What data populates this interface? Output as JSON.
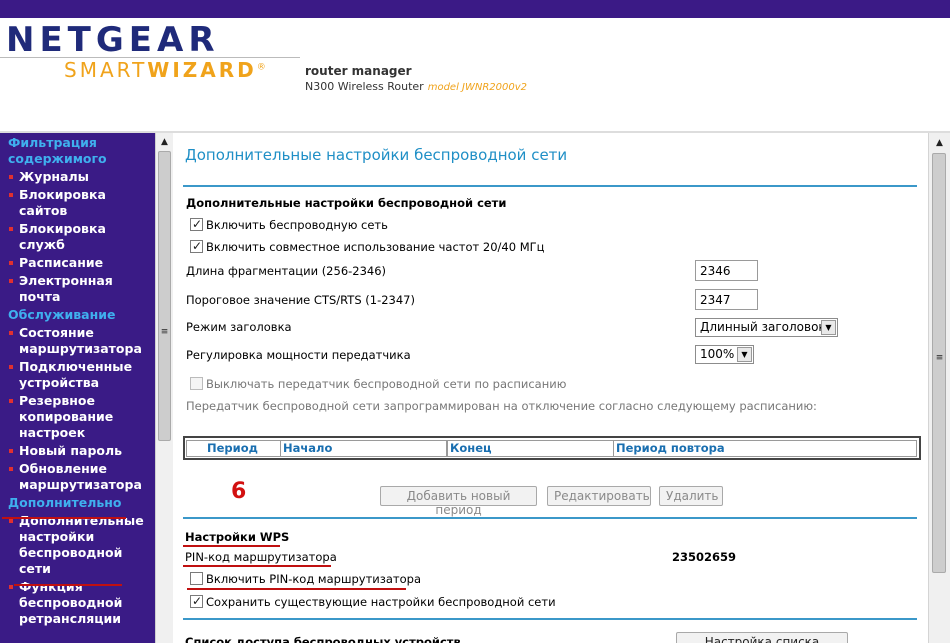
{
  "header": {
    "brand": "NETGEAR",
    "smart": "SMART",
    "wizard": "WIZARD",
    "registered": "®",
    "product_title": "router manager",
    "product_sub": "N300 Wireless Router",
    "model": "model JWNR2000v2"
  },
  "sidebar": {
    "items": [
      {
        "type": "section",
        "label": "Фильтрация содержимого"
      },
      {
        "type": "item",
        "label": "Журналы"
      },
      {
        "type": "item",
        "label": "Блокировка сайтов"
      },
      {
        "type": "item",
        "label": "Блокировка служб"
      },
      {
        "type": "item",
        "label": "Расписание"
      },
      {
        "type": "item",
        "label": "Электронная почта"
      },
      {
        "type": "section",
        "label": "Обслуживание"
      },
      {
        "type": "item",
        "label": "Состояние маршрутизатора"
      },
      {
        "type": "item",
        "label": "Подключенные устройства"
      },
      {
        "type": "item",
        "label": "Резервное копирование настроек"
      },
      {
        "type": "item",
        "label": "Новый пароль"
      },
      {
        "type": "item",
        "label": "Обновление маршрутизатора"
      },
      {
        "type": "section",
        "label": "Дополнительно"
      },
      {
        "type": "item",
        "label": "Дополнительные настройки беспроводной сети"
      },
      {
        "type": "item",
        "label": "Функция беспроводной ретрансляции"
      }
    ]
  },
  "main": {
    "page_title": "Дополнительные настройки беспроводной сети",
    "section_title": "Дополнительные настройки беспроводной сети",
    "enable_wireless": {
      "label": "Включить беспроводную сеть",
      "checked": true
    },
    "enable_coexist": {
      "label": "Включить совместное использование частот 20/40 МГц",
      "checked": true
    },
    "frag_label": "Длина фрагментации (256-2346)",
    "frag_value": "2346",
    "cts_label": "Пороговое значение CTS/RTS (1-2347)",
    "cts_value": "2347",
    "preamble_label": "Режим заголовка",
    "preamble_value": "Длинный заголовок",
    "power_label": "Регулировка мощности передатчика",
    "power_value": "100%",
    "schedule_off": {
      "label": "Выключать передатчик беспроводной сети по расписанию",
      "checked": false
    },
    "schedule_note": "Передатчик беспроводной сети запрограммирован на отключение согласно следующему расписанию:",
    "table_headers": [
      "Период",
      "Начало",
      "Конец",
      "Период повтора"
    ],
    "annotation": "6",
    "btn_add": "Добавить новый период",
    "btn_edit": "Редактировать",
    "btn_delete": "Удалить",
    "wps_title": "Настройки WPS",
    "pin_label": "PIN-код маршрутизатора",
    "pin_value": "23502659",
    "enable_pin": {
      "label": "Включить PIN-код маршрутизатора",
      "checked": false
    },
    "keep_settings": {
      "label": "Сохранить существующие настройки беспроводной сети",
      "checked": true
    },
    "access_list_label": "Список доступа беспроводных устройств",
    "access_list_button": "Настройка списка доступа"
  },
  "colors": {
    "sidebar_bg": "#3a1b86",
    "section_color": "#3fb0ee",
    "title_color": "#1f8fc6",
    "annotation_red": "#c01010"
  }
}
